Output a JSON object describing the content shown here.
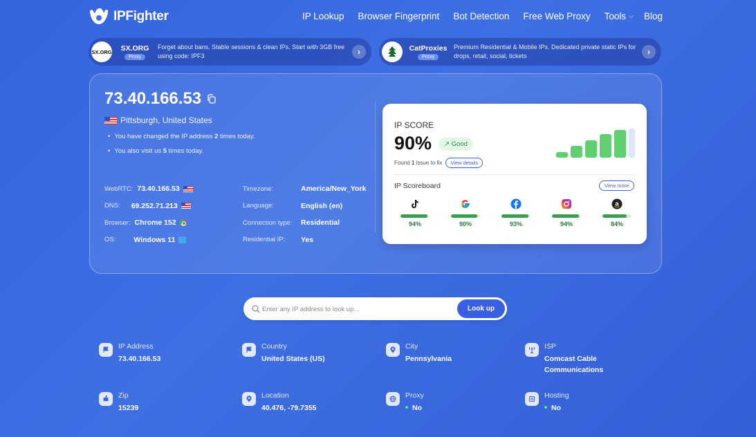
{
  "brand": {
    "name": "IPFighter"
  },
  "nav": {
    "links": [
      "IP Lookup",
      "Browser Fingerprint",
      "Bot Detection",
      "Free Web Proxy",
      "Tools"
    ],
    "blog": "Blog"
  },
  "promos": [
    {
      "logo_text": "SX.ORG",
      "name": "SX.ORG",
      "tag": "Proxy",
      "text": "Forget about bans. Stable sessions & clean IPs. Start with 3GB free using code: IPF3"
    },
    {
      "logo_text": "",
      "name": "CatProxies",
      "tag": "Proxy",
      "text": "Premium Residential & Mobile IPs. Dedicated private static IPs for drops, retail, social, tickets"
    }
  ],
  "summary": {
    "ip": "73.40.166.53",
    "location": "Pittsburgh, United States",
    "changed_pre": "You have changed the IP address ",
    "changed_count": "2",
    "changed_post": " times today.",
    "visit_pre": "You also visit us ",
    "visit_count": "5",
    "visit_post": " times today."
  },
  "details_left": [
    {
      "label": "WebRTC:",
      "value": "73.40.166.53"
    },
    {
      "label": "DNS:",
      "value": "69.252.71.213"
    },
    {
      "label": "Browser:",
      "value": "Chrome 152"
    },
    {
      "label": "OS:",
      "value": "Windows 11"
    }
  ],
  "details_right": [
    {
      "label": "Timezone:",
      "value": "America/New_York"
    },
    {
      "label": "Language:",
      "value": "English (en)"
    },
    {
      "label": "Connection type:",
      "value": "Residential"
    },
    {
      "label": "Residential IP:",
      "value": "Yes"
    }
  ],
  "score": {
    "title": "IP SCORE",
    "percent": "90%",
    "badge": "Good",
    "fix_pre": "Found ",
    "fix_count": "1",
    "fix_post": " issue to fix",
    "view_details": "View details",
    "board_title": "IP Scoreboard",
    "view_more": "View more",
    "levels": [
      0.2,
      0.4,
      0.6,
      0.8,
      0.95
    ],
    "services": [
      {
        "icon": "tiktok-icon",
        "percent": "94%",
        "value": 94
      },
      {
        "icon": "google-icon",
        "percent": "90%",
        "value": 90
      },
      {
        "icon": "facebook-icon",
        "percent": "93%",
        "value": 93
      },
      {
        "icon": "instagram-icon",
        "percent": "94%",
        "value": 94
      },
      {
        "icon": "amazon-icon",
        "percent": "84%",
        "value": 84
      }
    ]
  },
  "search": {
    "placeholder": "Enter any IP address to look up...",
    "button": "Look up"
  },
  "info": {
    "ip_address": {
      "label": "IP Address",
      "value": "73.40.166.53"
    },
    "country": {
      "label": "Country",
      "value": "United States (US)"
    },
    "city": {
      "label": "City",
      "value": "Pennsylvania"
    },
    "isp": {
      "label": "ISP",
      "value_line1": "Comcast Cable",
      "value_line2": "Communications"
    },
    "zip": {
      "label": "Zip",
      "value": "15239"
    },
    "location": {
      "label": "Location",
      "value": "40.476, -79.7355"
    },
    "proxy": {
      "label": "Proxy",
      "value": "No"
    },
    "hosting": {
      "label": "Hosting",
      "value": "No"
    }
  },
  "colors": {
    "accent": "#3a5fe0",
    "good": "#3c9d4c",
    "bar": "#60cf6f"
  }
}
